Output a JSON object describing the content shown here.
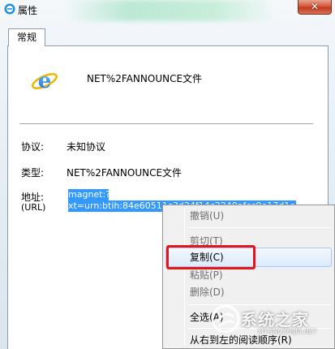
{
  "window": {
    "title": "属性",
    "close_glyph": "✕"
  },
  "tabs": [
    {
      "label": "常规",
      "active": true
    }
  ],
  "general": {
    "file_name": "NET%2FANNOUNCE文件",
    "protocol_label": "协议:",
    "protocol_value": "未知协议",
    "type_label": "类型:",
    "type_value": "NET%2FANNOUNCE文件",
    "address_label": "地址:",
    "address_sublabel": "(URL)",
    "address_value_line1": "magnet:?",
    "address_value_line2": "xt=urn:btih:84e60511c3d24f14c2240afcc9e17d1e72eb"
  },
  "context_menu": {
    "items": [
      {
        "label": "撤销(U)",
        "enabled": false
      },
      {
        "label": "剪切(T)",
        "enabled": false
      },
      {
        "label": "复制(C)",
        "enabled": true,
        "highlighted": true
      },
      {
        "label": "粘贴(P)",
        "enabled": false
      },
      {
        "label": "删除(D)",
        "enabled": false
      },
      {
        "label": "全选(A)",
        "enabled": true
      },
      {
        "label": "从右到左的阅读顺序(R)",
        "enabled": true
      }
    ]
  },
  "watermark": {
    "text": "系统之家",
    "subtext": "XITONGZHIJIA.NET"
  },
  "colors": {
    "selection": "#3399ff",
    "highlight_box": "#e5141a",
    "close_button": "#c23b1c"
  }
}
